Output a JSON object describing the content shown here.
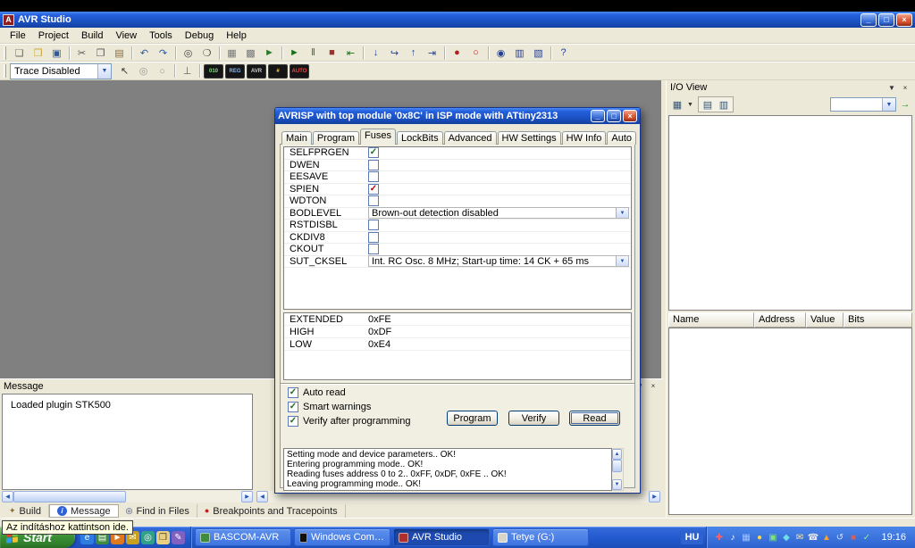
{
  "chrome": {
    "minimize": "_",
    "restore": "□",
    "close": "×",
    "dropdown": "▼",
    "up": "▲",
    "down": "▼",
    "left": "◀",
    "right": "▶"
  },
  "colors": {
    "titlebar": "#1f5bd3",
    "workspace": "#808080",
    "taskbar": "#2259ce",
    "start_button": "#3b9136",
    "close_button": "#d8512e",
    "panel": "#ece9d8",
    "check": "#1a6e1a",
    "warning_check": "#c00000"
  },
  "app": {
    "title": "AVR Studio",
    "icon_glyph": "A",
    "menu": [
      {
        "label": "File",
        "name": "menu-file"
      },
      {
        "label": "Project",
        "name": "menu-project"
      },
      {
        "label": "Build",
        "name": "menu-build"
      },
      {
        "label": "View",
        "name": "menu-view"
      },
      {
        "label": "Tools",
        "name": "menu-tools"
      },
      {
        "label": "Debug",
        "name": "menu-debug"
      },
      {
        "label": "Help",
        "name": "menu-help"
      }
    ]
  },
  "toolbar_main": {
    "icons": [
      {
        "name": "new-file-icon",
        "glyph": "❏",
        "color": "#666666"
      },
      {
        "name": "open-file-icon",
        "glyph": "❒",
        "color": "#c9a227"
      },
      {
        "name": "save-icon",
        "glyph": "▣",
        "color": "#2c5aa0"
      },
      {
        "sep": true
      },
      {
        "name": "cut-icon",
        "glyph": "✂",
        "color": "#555555"
      },
      {
        "name": "copy-icon",
        "glyph": "❐",
        "color": "#555555"
      },
      {
        "name": "paste-icon",
        "glyph": "▤",
        "color": "#8a6d3b"
      },
      {
        "sep": true
      },
      {
        "name": "undo-icon",
        "glyph": "↶",
        "color": "#2c5aa0"
      },
      {
        "name": "redo-icon",
        "glyph": "↷",
        "color": "#2c5aa0"
      },
      {
        "sep": true
      },
      {
        "name": "find-icon",
        "glyph": "◎",
        "color": "#444444"
      },
      {
        "name": "find-in-files-icon",
        "glyph": "❍",
        "color": "#444444"
      },
      {
        "sep": true
      },
      {
        "name": "assemble-icon",
        "glyph": "▦",
        "color": "#777777"
      },
      {
        "name": "build-icon",
        "glyph": "▩",
        "color": "#777777"
      },
      {
        "name": "build-and-run-icon",
        "glyph": "►",
        "color": "#2c7a2c"
      },
      {
        "sep": true
      },
      {
        "name": "run-icon",
        "glyph": "►",
        "color": "#1b6e1b"
      },
      {
        "name": "pause-icon",
        "glyph": "‖",
        "color": "#1b6e1b"
      },
      {
        "name": "stop-icon",
        "glyph": "■",
        "color": "#a03030"
      },
      {
        "name": "reset-icon",
        "glyph": "⇤",
        "color": "#1b6e1b"
      },
      {
        "sep": true
      },
      {
        "name": "step-into-icon",
        "glyph": "↓",
        "color": "#27418f"
      },
      {
        "name": "step-over-icon",
        "glyph": "↪",
        "color": "#27418f"
      },
      {
        "name": "step-out-icon",
        "glyph": "↑",
        "color": "#27418f"
      },
      {
        "name": "run-to-cursor-icon",
        "glyph": "⇥",
        "color": "#27418f"
      },
      {
        "sep": true
      },
      {
        "name": "toggle-breakpoint-icon",
        "glyph": "●",
        "color": "#b02020"
      },
      {
        "name": "clear-breakpoints-icon",
        "glyph": "○",
        "color": "#b02020"
      },
      {
        "sep": true
      },
      {
        "name": "watch-icon",
        "glyph": "◉",
        "color": "#27418f"
      },
      {
        "name": "memory-icon",
        "glyph": "▥",
        "color": "#27418f"
      },
      {
        "name": "registers-icon",
        "glyph": "▧",
        "color": "#27418f"
      },
      {
        "sep": true
      },
      {
        "name": "help-icon",
        "glyph": "?",
        "color": "#27418f"
      }
    ]
  },
  "toolbar_trace": {
    "combo_value": "Trace Disabled",
    "icons": [
      {
        "name": "select-cursor-icon",
        "glyph": "↖",
        "color": "#333333"
      },
      {
        "name": "zoom-in-icon",
        "glyph": "◎",
        "color": "#999999"
      },
      {
        "name": "zoom-out-icon",
        "glyph": "○",
        "color": "#999999"
      },
      {
        "sep": true
      },
      {
        "name": "probe-icon",
        "glyph": "⊥",
        "color": "#555555"
      },
      {
        "sep": true
      },
      {
        "name": "trace-bits-icon",
        "text": "010",
        "bg": "#151515",
        "color": "#7ee07e"
      },
      {
        "name": "trace-registers-icon",
        "text": "REG",
        "bg": "#151515",
        "color": "#7ab8ff"
      },
      {
        "name": "device-icon",
        "text": "AVR",
        "bg": "#151515",
        "color": "#cccccc"
      },
      {
        "name": "hex-view-icon",
        "text": "#",
        "bg": "#151515",
        "color": "#ffd24a"
      },
      {
        "name": "auto-step-icon",
        "text": "AUTO",
        "bg": "#151515",
        "color": "#ff4040"
      }
    ]
  },
  "io_view": {
    "title": "I/O View",
    "filter_value": "",
    "columns": [
      "Name",
      "Address",
      "Value",
      "Bits"
    ],
    "toolbar": {
      "chip_glyph": "▦",
      "view_list_glyph": "▤",
      "view_grid_glyph": "▥",
      "go_glyph": "→"
    }
  },
  "message_panel": {
    "title": "Message",
    "lines": [
      "Loaded plugin STK500"
    ]
  },
  "bottom_tabs": [
    {
      "name": "tab-build",
      "label": "Build",
      "icon": "✦",
      "icon_color": "#8a6d3b"
    },
    {
      "name": "tab-message",
      "label": "Message",
      "icon": "i",
      "circle": true,
      "active": true
    },
    {
      "name": "tab-find-in-files",
      "label": "Find in Files",
      "icon": "◎",
      "icon_color": "#27418f"
    },
    {
      "name": "tab-breakpoints",
      "label": "Breakpoints and Tracepoints",
      "icon": "●",
      "icon_color": "#c02020"
    }
  ],
  "tooltip": "Az indításhoz kattintson ide.",
  "dialog": {
    "title": "AVRISP with top module '0x8C' in ISP mode with ATtiny2313",
    "tabs": [
      {
        "label": "Main",
        "name": "dialog-tab-main"
      },
      {
        "label": "Program",
        "name": "dialog-tab-program"
      },
      {
        "label": "Fuses",
        "name": "dialog-tab-fuses",
        "active": true
      },
      {
        "label": "LockBits",
        "name": "dialog-tab-lockbits"
      },
      {
        "label": "Advanced",
        "name": "dialog-tab-advanced"
      },
      {
        "label": "HW Settings",
        "name": "dialog-tab-hw-settings"
      },
      {
        "label": "HW Info",
        "name": "dialog-tab-hw-info"
      },
      {
        "label": "Auto",
        "name": "dialog-tab-auto"
      }
    ],
    "fuses": [
      {
        "name": "SELFPRGEN",
        "control": "check",
        "check": "✓"
      },
      {
        "name": "DWEN",
        "control": "check",
        "check": ""
      },
      {
        "name": "EESAVE",
        "control": "check",
        "check": ""
      },
      {
        "name": "SPIEN",
        "control": "check",
        "check": "✓",
        "warning": true
      },
      {
        "name": "WDTON",
        "control": "check",
        "check": ""
      },
      {
        "name": "BODLEVEL",
        "control": "select",
        "value": "Brown-out detection disabled"
      },
      {
        "name": "RSTDISBL",
        "control": "check",
        "check": ""
      },
      {
        "name": "CKDIV8",
        "control": "check",
        "check": ""
      },
      {
        "name": "CKOUT",
        "control": "check",
        "check": ""
      },
      {
        "name": "SUT_CKSEL",
        "control": "select",
        "value": "Int. RC Osc. 8 MHz; Start-up time: 14 CK + 65 ms"
      }
    ],
    "values": [
      {
        "label": "EXTENDED",
        "value": "0xFE"
      },
      {
        "label": "HIGH",
        "value": "0xDF"
      },
      {
        "label": "LOW",
        "value": "0xE4"
      }
    ],
    "options": [
      {
        "label": "Auto read",
        "check": "✓"
      },
      {
        "label": "Smart warnings",
        "check": "✓"
      },
      {
        "label": "Verify after programming",
        "check": "✓"
      }
    ],
    "buttons": [
      {
        "label": "Program",
        "name": "program-button"
      },
      {
        "label": "Verify",
        "name": "verify-button"
      },
      {
        "label": "Read",
        "name": "read-button"
      }
    ],
    "log": [
      "Setting mode and device parameters.. OK!",
      "Entering programming mode.. OK!",
      "Reading fuses address 0 to 2.. 0xFF, 0xDF, 0xFE .. OK!",
      "Leaving programming mode.. OK!"
    ]
  },
  "taskbar": {
    "start_label": "Start",
    "quick_launch": [
      {
        "name": "browser-quicklaunch-icon",
        "glyph": "e",
        "bg": "#2f7de0",
        "color": "#ffffff"
      },
      {
        "name": "show-desktop-icon",
        "glyph": "▤",
        "bg": "#3f8c3f",
        "color": "#ffffff"
      },
      {
        "name": "media-player-icon",
        "glyph": "►",
        "bg": "#e07820",
        "color": "#ffffff"
      },
      {
        "name": "mail-quicklaunch-icon",
        "glyph": "✉",
        "bg": "#c8a020",
        "color": "#ffffff"
      },
      {
        "name": "messenger-icon",
        "glyph": "◎",
        "bg": "#30a088",
        "color": "#ffffff"
      },
      {
        "name": "folder-quicklaunch-icon",
        "glyph": "❒",
        "bg": "#e8d080",
        "color": "#554433"
      },
      {
        "name": "notes-icon",
        "glyph": "✎",
        "bg": "#8060c0",
        "color": "#ffffff"
      }
    ],
    "items": [
      {
        "name": "task-bascom-avr",
        "label": "BASCOM-AVR",
        "icon_bg": "#3f8c3f"
      },
      {
        "name": "task-windows-command",
        "label": "Windows Command...",
        "icon_bg": "#101010"
      },
      {
        "name": "task-avr-studio",
        "label": "AVR Studio",
        "icon_bg": "#b03030",
        "active": true
      },
      {
        "name": "task-tetye-drive",
        "label": "Tetye (G:)",
        "icon_bg": "#d8d4c8"
      }
    ],
    "language": "HU",
    "tray_icons": [
      {
        "name": "antivirus-tray-icon",
        "glyph": "✚",
        "color": "#ff6060"
      },
      {
        "name": "volume-tray-icon",
        "glyph": "♪",
        "color": "#ffffff"
      },
      {
        "name": "network-tray-icon",
        "glyph": "▦",
        "color": "#9fc3ff"
      },
      {
        "name": "update-tray-icon",
        "glyph": "●",
        "color": "#ffd24a"
      },
      {
        "name": "firewall-tray-icon",
        "glyph": "▣",
        "color": "#7ee07e"
      },
      {
        "name": "messenger-tray-icon",
        "glyph": "◆",
        "color": "#6fe0e8"
      },
      {
        "name": "mail-tray-icon",
        "glyph": "✉",
        "color": "#ffe9a0"
      },
      {
        "name": "device-tray-icon",
        "glyph": "☎",
        "color": "#e8e8e8"
      },
      {
        "name": "warning-tray-icon",
        "glyph": "▲",
        "color": "#ffa030"
      },
      {
        "name": "sync-tray-icon",
        "glyph": "↺",
        "color": "#cfe0ff"
      },
      {
        "name": "power-tray-icon",
        "glyph": "■",
        "color": "#d06060"
      },
      {
        "name": "scheduler-tray-icon",
        "glyph": "✓",
        "color": "#8ef08e"
      }
    ],
    "time": "19:16"
  }
}
